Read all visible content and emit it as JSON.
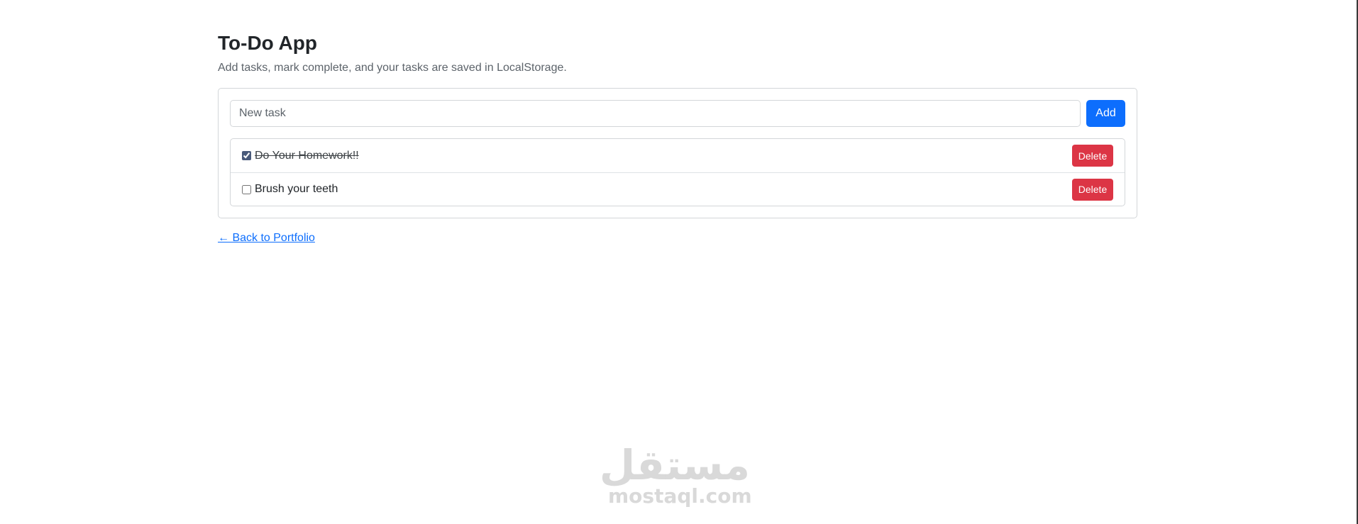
{
  "header": {
    "title": "To-Do App",
    "subtitle": "Add tasks, mark complete, and your tasks are saved in LocalStorage."
  },
  "form": {
    "placeholder": "New task",
    "add_label": "Add"
  },
  "tasks": [
    {
      "label": "Do Your Homework!!",
      "completed": true,
      "delete_label": "Delete"
    },
    {
      "label": "Brush your teeth",
      "completed": false,
      "delete_label": "Delete"
    }
  ],
  "footer": {
    "back_link": "← Back to Portfolio"
  },
  "watermark": {
    "logo_text": "مستقل",
    "domain": "mostaql.com"
  },
  "colors": {
    "primary": "#0d6efd",
    "danger": "#dc3545",
    "border": "#d3d6d9",
    "text": "#212529",
    "muted": "#5c636a"
  },
  "icons": {
    "back_arrow": "left-arrow-icon"
  }
}
